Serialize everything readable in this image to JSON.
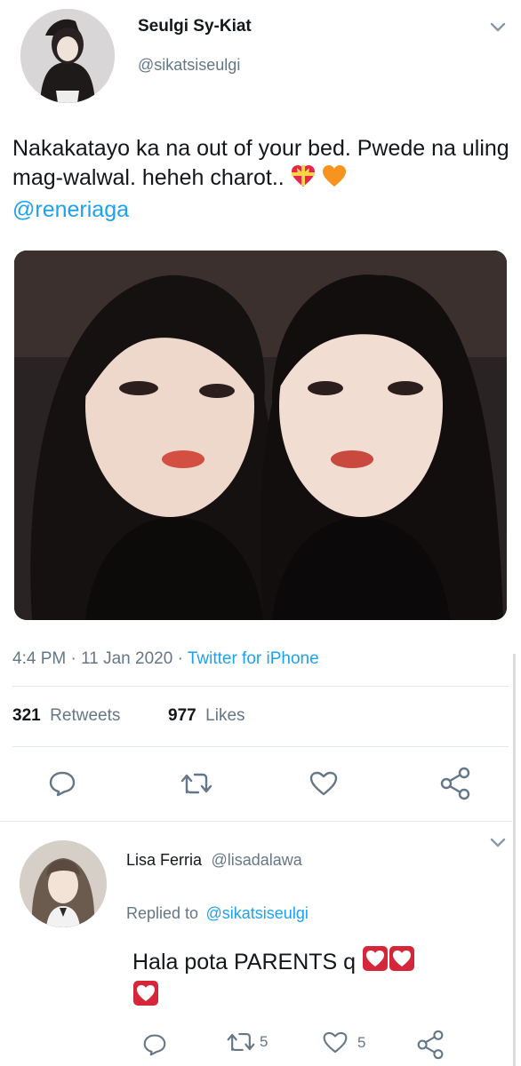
{
  "tweet": {
    "author_name": "Seulgi Sy-Kiat",
    "author_handle": "@sikatsiseulgi",
    "text": "Nakakatayo ka na out of your bed. Pwede na uling mag-walwal. heheh charot..",
    "mention": "@reneriaga",
    "emojis": [
      "gift-heart-emoji",
      "orange-heart-emoji"
    ],
    "time": "4:4 PM",
    "date": "11 Jan 2020",
    "separator": "·",
    "source": "Twitter for iPhone",
    "retweets_count": "321",
    "retweets_label": "Retweets",
    "likes_count": "977",
    "likes_label": "Likes",
    "actions": [
      "reply-icon",
      "retweet-icon",
      "like-icon",
      "share-icon"
    ]
  },
  "reply": {
    "author_name": "Lisa Ferria",
    "author_handle": "@lisadalawa",
    "replied_to_label": "Replied to",
    "replied_to_handle": "@sikatsiseulgi",
    "text": "Hala pota PARENTS q",
    "emojis": [
      "white-heart-emoji",
      "white-heart-emoji",
      "white-heart-emoji"
    ],
    "retweet_count": "5",
    "like_count": "5"
  },
  "colors": {
    "link": "#1da1f2",
    "secondary_text": "#657786",
    "primary_text": "#14171a",
    "divider": "#e1e8ed"
  }
}
